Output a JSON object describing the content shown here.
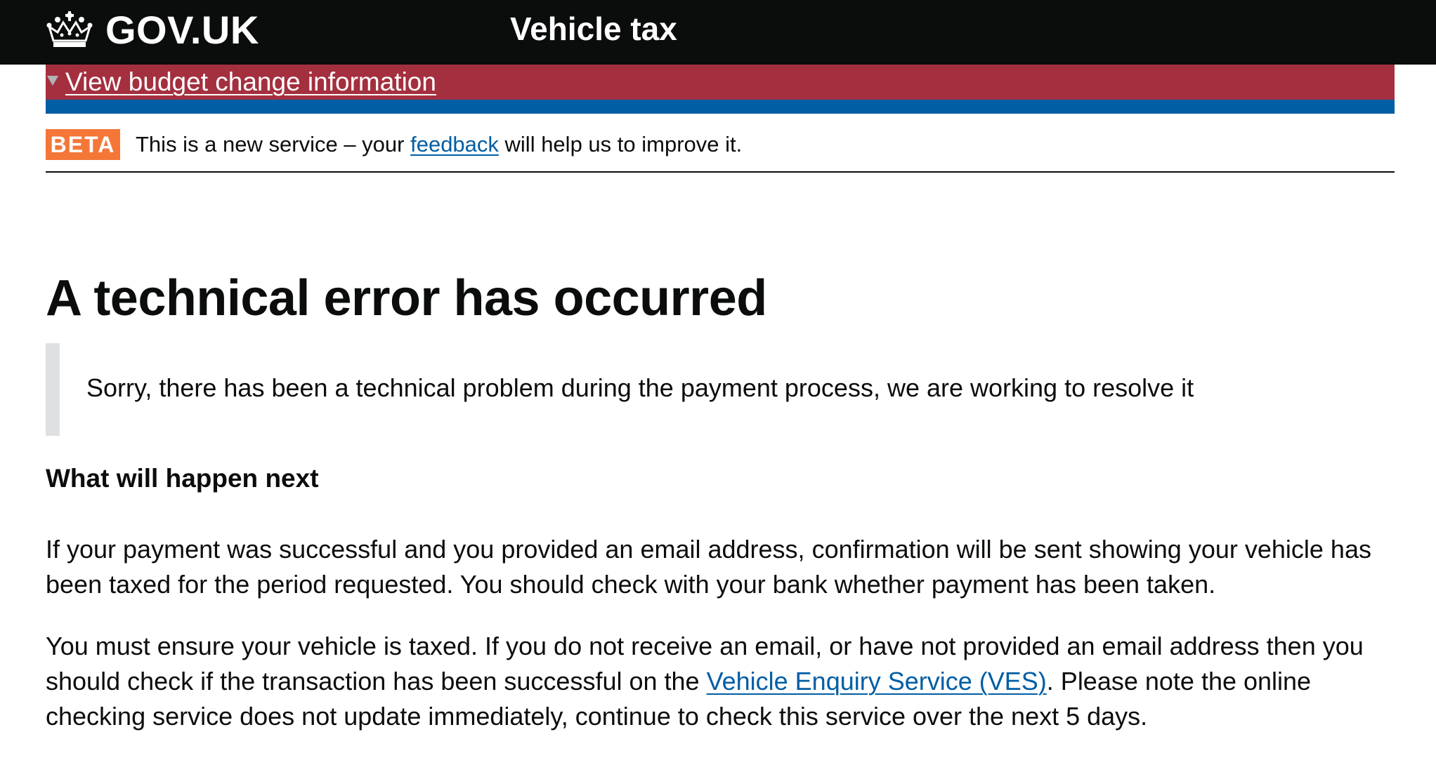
{
  "header": {
    "logo_text": "GOV.UK",
    "service_name": "Vehicle tax"
  },
  "budget_banner": {
    "link_text": "View budget change information"
  },
  "phase_banner": {
    "tag": "BETA",
    "text_before": "This is a new service – your ",
    "link_text": "feedback",
    "text_after": " will help us to improve it."
  },
  "main": {
    "title": "A technical error has occurred",
    "inset": "Sorry, there has been a technical problem during the payment process, we are working to resolve it",
    "heading": "What will happen next",
    "para1": "If your payment was successful and you provided an email address, confirmation will be sent showing your vehicle has been taxed for the period requested. You should check with your bank whether payment has been taken.",
    "para2_before": "You must ensure your vehicle is taxed. If you do not receive an email, or have not provided an email address then you should check if the transaction has been successful on the ",
    "para2_link": "Vehicle Enquiry Service (VES)",
    "para2_after": ". Please note the online checking service does not update immediately, continue to check this service over the next 5 days."
  },
  "colors": {
    "header_bg": "#0b0c0c",
    "budget_banner_bg": "#a4303f",
    "stripe_blue": "#005ea5",
    "beta_tag": "#f47738",
    "link": "#005ea5",
    "inset_border": "#dee0e2"
  },
  "icons": {
    "logo": "crown-icon",
    "budget_toggle": "triangle-down-icon"
  }
}
